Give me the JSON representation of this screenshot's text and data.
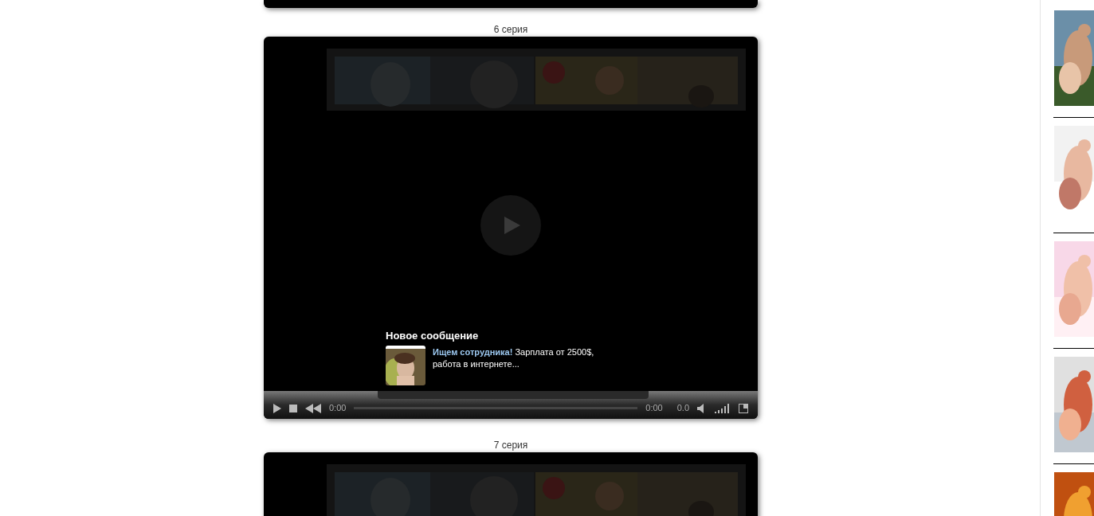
{
  "episodes": [
    {
      "title": "6 серия",
      "player": {
        "kind": "full",
        "notification": {
          "title": "Новое сообщение",
          "link": "Ищем сотрудника!",
          "text": "Зарплата от 2500$, работа в интернете..."
        },
        "elapsed": "0:00",
        "duration": "0:00",
        "speed": "0.0"
      }
    },
    {
      "title": "7 серия",
      "player": {
        "kind": "cut"
      }
    }
  ]
}
